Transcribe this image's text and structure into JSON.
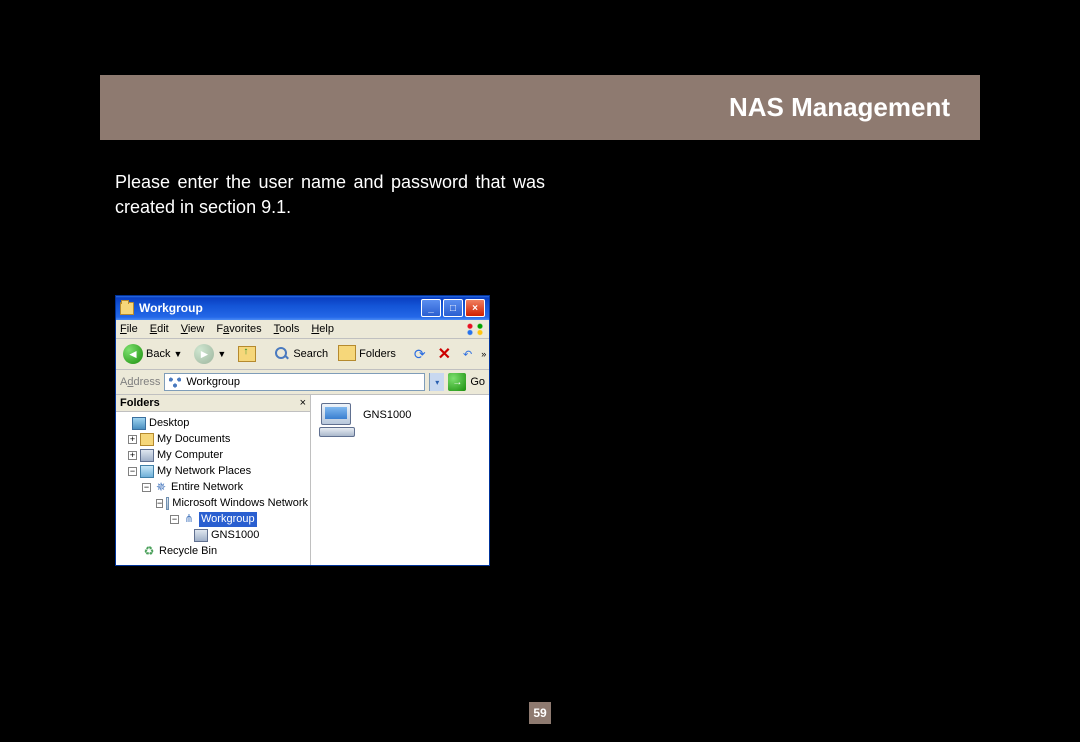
{
  "header": {
    "title": "NAS Management"
  },
  "body_text": "Please enter the user name and password that was created in section 9.1.",
  "page_number": "59",
  "window": {
    "title": "Workgroup",
    "menu": {
      "file": "File",
      "edit": "Edit",
      "view": "View",
      "favorites": "Favorites",
      "tools": "Tools",
      "help": "Help"
    },
    "toolbar": {
      "back": "Back",
      "search": "Search",
      "folders": "Folders"
    },
    "address": {
      "label": "Address",
      "value": "Workgroup",
      "go": "Go"
    },
    "folders_pane": {
      "header": "Folders",
      "tree": {
        "desktop": "Desktop",
        "my_documents": "My Documents",
        "my_computer": "My Computer",
        "my_network_places": "My Network Places",
        "entire_network": "Entire Network",
        "ms_windows_network": "Microsoft Windows Network",
        "workgroup": "Workgroup",
        "gns1000": "GNS1000",
        "recycle_bin": "Recycle Bin"
      }
    },
    "content": {
      "item": "GNS1000"
    }
  }
}
